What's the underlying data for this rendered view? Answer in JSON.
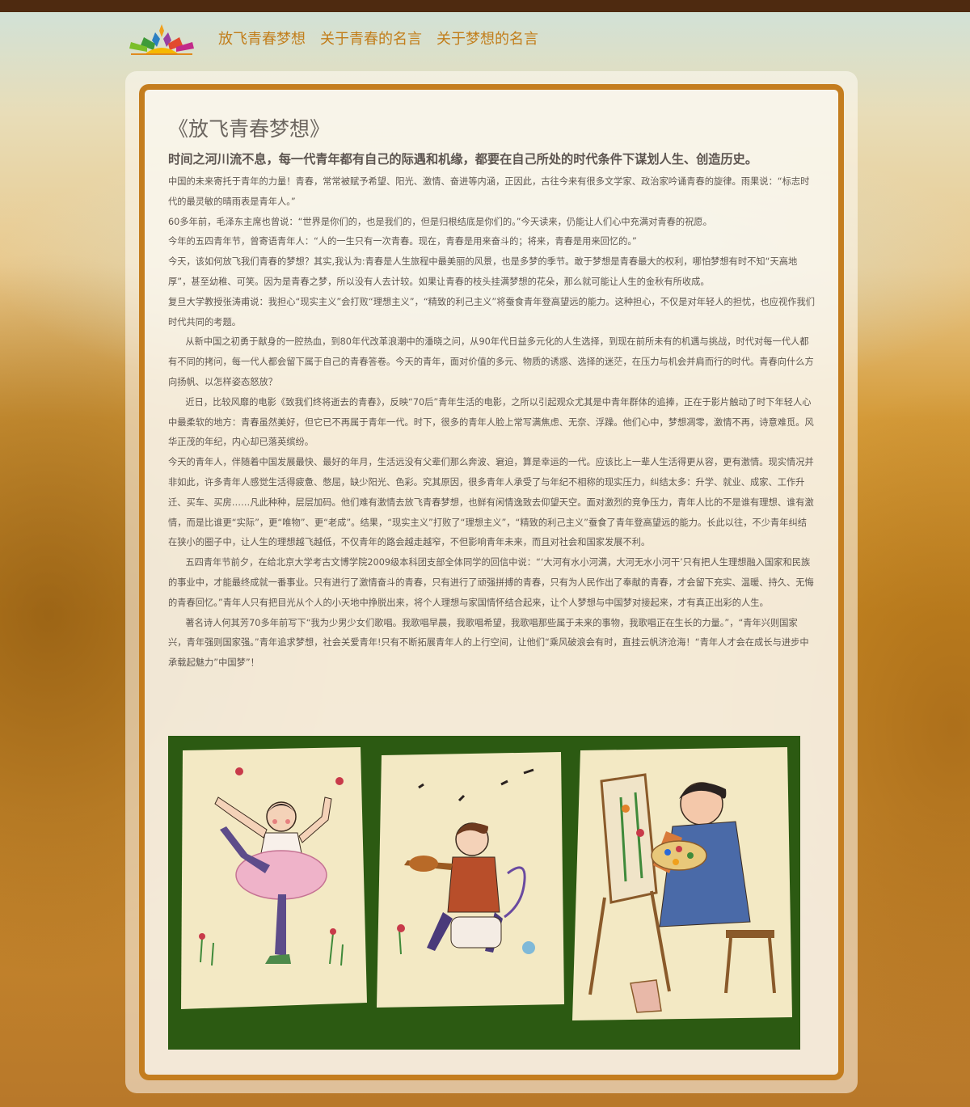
{
  "nav": {
    "items": [
      "放飞青春梦想",
      "关于青春的名言",
      "关于梦想的名言"
    ]
  },
  "article": {
    "title": "《放飞青春梦想》",
    "subtitle": "时间之河川流不息，每一代青年都有自己的际遇和机缘，都要在自己所处的时代条件下谋划人生、创造历史。",
    "paragraphs": [
      "中国的未来寄托于青年的力量！青春，常常被赋予希望、阳光、激情、奋进等内涵，正因此，古往今来有很多文学家、政治家吟诵青春的旋律。雨果说：“标志时代的最灵敏的晴雨表是青年人。”",
      "60多年前，毛泽东主席也曾说：“世界是你们的，也是我们的，但是归根结底是你们的。”今天读来，仍能让人们心中充满对青春的祝愿。",
      "今年的五四青年节，曾寄语青年人：“人的一生只有一次青春。现在，青春是用来奋斗的；将来，青春是用来回忆的。”",
      "今天，该如何放飞我们青春的梦想？其实,我认为:青春是人生旅程中最美丽的风景，也是多梦的季节。敢于梦想是青春最大的权利，哪怕梦想有时不知“天高地厚”，甚至幼稚、可笑。因为是青春之梦，所以没有人去计较。如果让青春的枝头挂满梦想的花朵，那么就可能让人生的金秋有所收成。",
      "复旦大学教授张涛甫说：我担心“现实主义”会打败“理想主义”，“精致的利己主义”将蚕食青年登高望远的能力。这种担心，不仅是对年轻人的担忧，也应视作我们时代共同的考题。",
      "从新中国之初勇于献身的一腔热血，到80年代改革浪潮中的潘晓之问，从90年代日益多元化的人生选择，到现在前所未有的机遇与挑战，时代对每一代人都有不同的拷问，每一代人都会留下属于自己的青春答卷。今天的青年，面对价值的多元、物质的诱惑、选择的迷茫，在压力与机会并肩而行的时代。青春向什么方向扬帆、以怎样姿态怒放？",
      "近日，比较风靡的电影《致我们终将逝去的青春》，反映“70后”青年生活的电影，之所以引起观众尤其是中青年群体的追捧，正在于影片触动了时下年轻人心中最柔软的地方：青春虽然美好，但它已不再属于青年一代。时下，很多的青年人脸上常写满焦虑、无奈、浮躁。他们心中，梦想凋零，激情不再，诗意难觅。风华正茂的年纪，内心却已落英缤纷。",
      "今天的青年人，伴随着中国发展最快、最好的年月，生活远没有父辈们那么奔波、窘迫，算是幸运的一代。应该比上一辈人生活得更从容，更有激情。现实情况并非如此，许多青年人感觉生活得疲惫、憋屈，缺少阳光、色彩。究其原因，很多青年人承受了与年纪不相称的现实压力，纠结太多：升学、就业、成家、工作升迁、买车、买房……凡此种种，层层加码。他们难有激情去放飞青春梦想，也鲜有闲情逸致去仰望天空。面对激烈的竞争压力，青年人比的不是谁有理想、谁有激情，而是比谁更“实际”，更“唯物”、更“老成”。结果，“现实主义”打败了“理想主义”，“精致的利己主义”蚕食了青年登高望远的能力。长此以往，不少青年纠结在狭小的圈子中，让人生的理想越飞越低，不仅青年的路会越走越窄，不但影响青年未来，而且对社会和国家发展不利。",
      "五四青年节前夕，在给北京大学考古文博学院2009级本科团支部全体同学的回信中说：“‘大河有水小河满，大河无水小河干’只有把人生理想融入国家和民族的事业中，才能最终成就一番事业。只有进行了激情奋斗的青春，只有进行了顽强拼搏的青春，只有为人民作出了奉献的青春，才会留下充实、温暖、持久、无悔的青春回忆。”青年人只有把目光从个人的小天地中挣脱出来，将个人理想与家国情怀结合起来，让个人梦想与中国梦对接起来，才有真正出彩的人生。",
      "著名诗人何其芳70多年前写下“我为少男少女们歌唱。我歌唱早晨，我歌唱希望，我歌唱那些属于未来的事物，我歌唱正在生长的力量。”，“青年兴则国家兴，青年强则国家强。”青年追求梦想，社会关爱青年!只有不断拓展青年人的上行空间，让他们“乘风破浪会有时，直挂云帆济沧海！“青年人才会在成长与进步中承载起魅力”中国梦”！"
    ],
    "indented": [
      false,
      false,
      false,
      false,
      false,
      true,
      true,
      false,
      true,
      true
    ]
  },
  "colors": {
    "accent": "#c47d1e",
    "nav_text": "#c27d1a",
    "top_bar": "#4e2a10",
    "illustration_bg": "#2c5a12"
  },
  "icons": {
    "logo": "sunrise-petals-logo"
  }
}
